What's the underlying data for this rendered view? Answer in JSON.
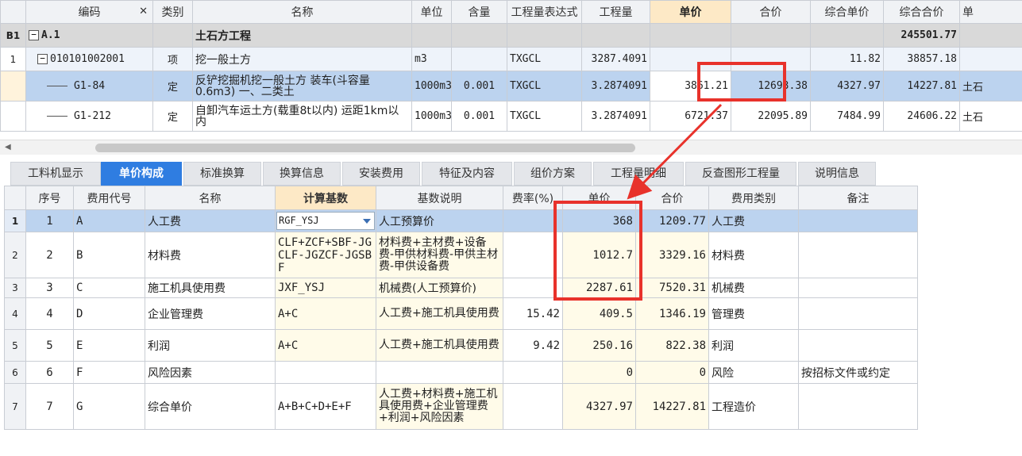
{
  "top_grid": {
    "headers": {
      "code": "编码",
      "close_mark": "✕",
      "category": "类别",
      "name": "名称",
      "unit": "单位",
      "content": "含量",
      "expr": "工程量表达式",
      "qty": "工程量",
      "unit_price": "单价",
      "total": "合价",
      "comp_unit_price": "综合单价",
      "comp_total": "综合合价",
      "extra": "单"
    },
    "rows": [
      {
        "rowhdr": "B1",
        "code": "A.1",
        "category": "",
        "name": "土石方工程",
        "unit": "",
        "content": "",
        "expr": "",
        "qty": "",
        "unit_price": "",
        "total": "",
        "comp_unit_price": "",
        "comp_total": "245501.77",
        "extra": ""
      },
      {
        "rowhdr": "1",
        "code": "010101002001",
        "category": "项",
        "name": "挖一般土方",
        "unit": "m3",
        "content": "",
        "expr": "TXGCL",
        "qty": "3287.4091",
        "unit_price": "",
        "total": "",
        "comp_unit_price": "11.82",
        "comp_total": "38857.18",
        "extra": ""
      },
      {
        "rowhdr": "",
        "code": "G1-84",
        "category": "定",
        "name": "反铲挖掘机挖一般土方 装车(斗容量0.6m3) 一、二类土",
        "unit": "1000m3",
        "content": "0.001",
        "expr": "TXGCL",
        "qty": "3.2874091",
        "unit_price": "3861.21",
        "total": "12693.38",
        "comp_unit_price": "4327.97",
        "comp_total": "14227.81",
        "extra": "土石"
      },
      {
        "rowhdr": "",
        "code": "G1-212",
        "category": "定",
        "name": "自卸汽车运土方(载重8t以内) 运距1km以内",
        "unit": "1000m3",
        "content": "0.001",
        "expr": "TXGCL",
        "qty": "3.2874091",
        "unit_price": "6721.37",
        "total": "22095.89",
        "comp_unit_price": "7484.99",
        "comp_total": "24606.22",
        "extra": "土石"
      }
    ],
    "tree_collapse_symbol": "−"
  },
  "scrollbar": {
    "left_arrow": "◀"
  },
  "tabs": [
    "工料机显示",
    "单价构成",
    "标准换算",
    "换算信息",
    "安装费用",
    "特征及内容",
    "组价方案",
    "工程量明细",
    "反查图形工程量",
    "说明信息"
  ],
  "active_tab": "单价构成",
  "bottom_grid": {
    "headers": {
      "seq": "序号",
      "fee_code": "费用代号",
      "name": "名称",
      "basis": "计算基数",
      "basis_desc": "基数说明",
      "rate": "费率(%)",
      "unit_price": "单价",
      "total": "合价",
      "fee_type": "费用类别",
      "remark": "备注"
    },
    "rows": [
      {
        "rowhdr": "1",
        "seq": "1",
        "fee_code": "A",
        "name": "人工费",
        "basis": "RGF_YSJ",
        "basis_desc": "人工预算价",
        "rate": "",
        "unit_price": "368",
        "total": "1209.77",
        "fee_type": "人工费",
        "remark": ""
      },
      {
        "rowhdr": "2",
        "seq": "2",
        "fee_code": "B",
        "name": "材料费",
        "basis": "CLF+ZCF+SBF-JGCLF-JGZCF-JGSBF",
        "basis_desc": "材料费+主材费+设备费-甲供材料费-甲供主材费-甲供设备费",
        "rate": "",
        "unit_price": "1012.7",
        "total": "3329.16",
        "fee_type": "材料费",
        "remark": ""
      },
      {
        "rowhdr": "3",
        "seq": "3",
        "fee_code": "C",
        "name": "施工机具使用费",
        "basis": "JXF_YSJ",
        "basis_desc": "机械费(人工预算价)",
        "rate": "",
        "unit_price": "2287.61",
        "total": "7520.31",
        "fee_type": "机械费",
        "remark": ""
      },
      {
        "rowhdr": "4",
        "seq": "4",
        "fee_code": "D",
        "name": "企业管理费",
        "basis": "A+C",
        "basis_desc": "人工费+施工机具使用费",
        "rate": "15.42",
        "unit_price": "409.5",
        "total": "1346.19",
        "fee_type": "管理费",
        "remark": ""
      },
      {
        "rowhdr": "5",
        "seq": "5",
        "fee_code": "E",
        "name": "利润",
        "basis": "A+C",
        "basis_desc": "人工费+施工机具使用费",
        "rate": "9.42",
        "unit_price": "250.16",
        "total": "822.38",
        "fee_type": "利润",
        "remark": ""
      },
      {
        "rowhdr": "6",
        "seq": "6",
        "fee_code": "F",
        "name": "风险因素",
        "basis": "",
        "basis_desc": "",
        "rate": "",
        "unit_price": "0",
        "total": "0",
        "fee_type": "风险",
        "remark": "按招标文件或约定"
      },
      {
        "rowhdr": "7",
        "seq": "7",
        "fee_code": "G",
        "name": "综合单价",
        "basis": "A+B+C+D+E+F",
        "basis_desc": "人工费+材料费+施工机具使用费+企业管理费+利润+风险因素",
        "rate": "",
        "unit_price": "4327.97",
        "total": "14227.81",
        "fee_type": "工程造价",
        "remark": ""
      }
    ]
  },
  "colors": {
    "selected_row": "#bcd3ef",
    "active_tab": "#2f7de1",
    "highlight_header": "#fde9c6",
    "annotation": "#e8322b",
    "group_row": "#d9d9d9"
  }
}
